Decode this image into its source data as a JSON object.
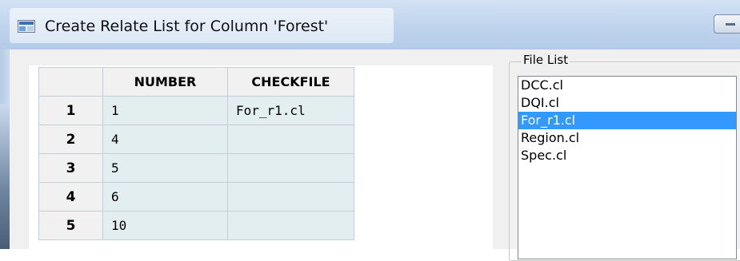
{
  "window": {
    "title": "Create Relate List for Column 'Forest'"
  },
  "grid": {
    "columns": [
      "NUMBER",
      "CHECKFILE"
    ],
    "rows": [
      {
        "row": "1",
        "number": "1",
        "checkfile": "For_r1.cl"
      },
      {
        "row": "2",
        "number": "4",
        "checkfile": ""
      },
      {
        "row": "3",
        "number": "5",
        "checkfile": ""
      },
      {
        "row": "4",
        "number": "6",
        "checkfile": ""
      },
      {
        "row": "5",
        "number": "10",
        "checkfile": ""
      }
    ]
  },
  "file_list": {
    "label": "File List",
    "items": [
      "DCC.cl",
      "DQI.cl",
      "For_r1.cl",
      "Region.cl",
      "Spec.cl"
    ],
    "selected": "For_r1.cl"
  },
  "colors": {
    "selection": "#3399ff",
    "cell_background": "#e3eef0",
    "header_background": "#f1f1f1"
  }
}
